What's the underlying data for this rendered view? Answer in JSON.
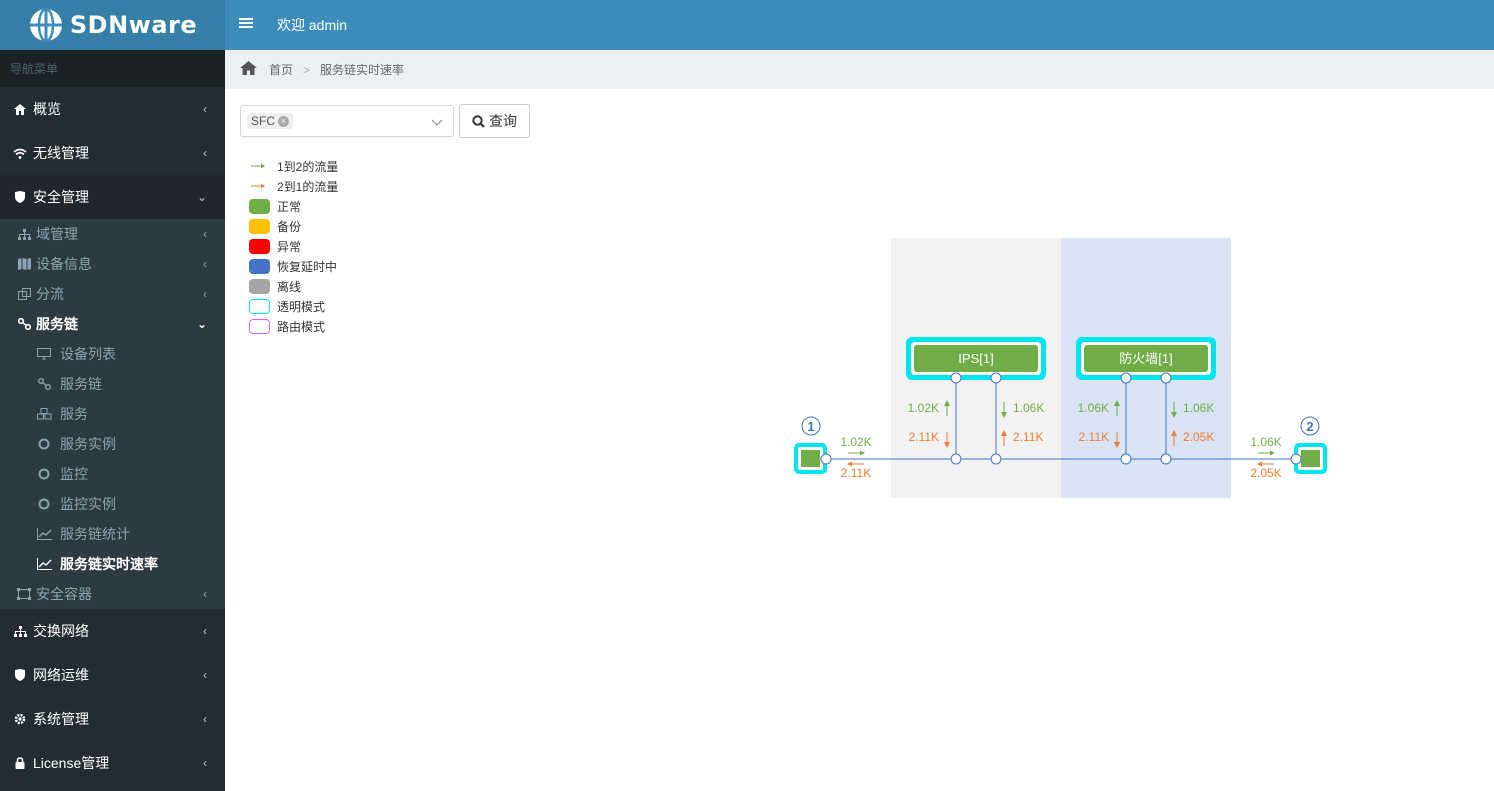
{
  "app": {
    "brand": "SDNware",
    "welcome": "欢迎 admin"
  },
  "sidebar": {
    "header": "导航菜单",
    "items": [
      {
        "label": "概览",
        "icon": "home-icon"
      },
      {
        "label": "无线管理",
        "icon": "wifi-icon"
      },
      {
        "label": "安全管理",
        "icon": "shield-icon"
      },
      {
        "label": "交换网络",
        "icon": "sitemap-icon"
      },
      {
        "label": "网络运维",
        "icon": "shield-icon"
      },
      {
        "label": "系统管理",
        "icon": "gear-icon"
      },
      {
        "label": "License管理",
        "icon": "lock-icon"
      }
    ],
    "security_sub": [
      {
        "label": "域管理",
        "icon": "sitemap-icon"
      },
      {
        "label": "设备信息",
        "icon": "map-icon"
      },
      {
        "label": "分流",
        "icon": "split-icon"
      },
      {
        "label": "服务链",
        "icon": "link-icon"
      },
      {
        "label": "安全容器",
        "icon": "container-icon"
      }
    ],
    "chain_sub": [
      {
        "label": "设备列表",
        "icon": "monitor-icon"
      },
      {
        "label": "服务链",
        "icon": "link-icon"
      },
      {
        "label": "服务",
        "icon": "cubes-icon"
      },
      {
        "label": "服务实例",
        "icon": "circle-icon"
      },
      {
        "label": "监控",
        "icon": "circle-icon"
      },
      {
        "label": "监控实例",
        "icon": "circle-icon"
      },
      {
        "label": "服务链统计",
        "icon": "line-chart-icon"
      },
      {
        "label": "服务链实时速率",
        "icon": "line-chart-icon"
      }
    ]
  },
  "breadcrumb": {
    "home": "首页",
    "sep": ">",
    "current": "服务链实时速率"
  },
  "toolbar": {
    "selected_tag": "SFC",
    "tag_remove": "×",
    "query_label": "查询"
  },
  "legend": {
    "flow_1_2": "1到2的流量",
    "flow_2_1": "2到1的流量",
    "normal": "正常",
    "backup": "备份",
    "abnormal": "异常",
    "recovering": "恢复延时中",
    "offline": "离线",
    "transparent": "透明模式",
    "routing": "路由模式",
    "colors": {
      "flow_1_2": "#70ad47",
      "flow_2_1": "#ed7d31",
      "normal": "#70ad47",
      "backup": "#ffc000",
      "abnormal": "#ff0000",
      "recovering": "#4472c4",
      "offline": "#a5a5a5",
      "transparent": "#00e5ee",
      "routing": "#cc66ff"
    }
  },
  "topology": {
    "endpoint_left": "1",
    "endpoint_right": "2",
    "nodes": [
      {
        "label": "IPS[1]",
        "up_green": "1.02K",
        "down_green": "1.06K",
        "down_orange": "2.11K",
        "up_orange": "2.11K"
      },
      {
        "label": "防火墙[1]",
        "up_green": "1.06K",
        "down_green": "1.06K",
        "down_orange": "2.11K",
        "up_orange": "2.05K"
      }
    ],
    "left_link": {
      "green": "1.02K",
      "orange": "2.11K"
    },
    "right_link": {
      "green": "1.06K",
      "orange": "2.05K"
    }
  }
}
